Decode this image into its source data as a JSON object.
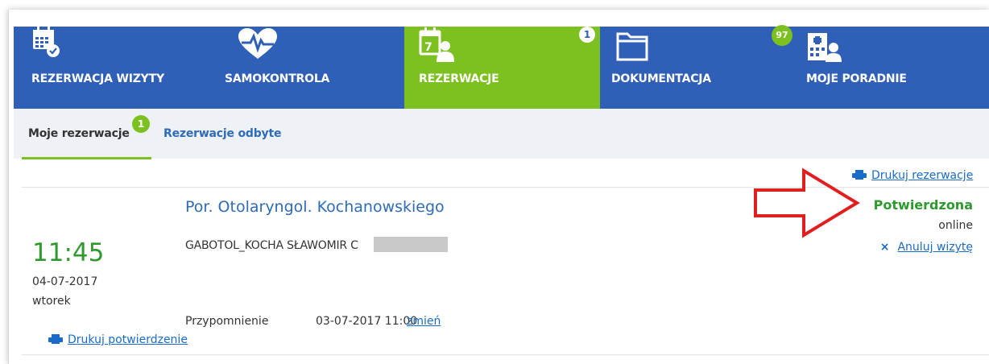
{
  "nav": {
    "tabs": [
      {
        "label": "REZERWACJA WIZYTY",
        "icon": "calendar-check-icon",
        "active": false,
        "badge": ""
      },
      {
        "label": "SAMOKONTROLA",
        "icon": "heart-pulse-icon",
        "active": false,
        "badge": ""
      },
      {
        "label": "REZERWACJE",
        "icon": "calendar-user-icon",
        "active": true,
        "badge": "1"
      },
      {
        "label": "DOKUMENTACJA",
        "icon": "folder-icon",
        "active": false,
        "badge": ""
      },
      {
        "label": "MOJE PORADNIE",
        "icon": "clinic-building-icon",
        "active": false,
        "badge": "97"
      }
    ],
    "color": "#2f5fb6",
    "active_color": "#7dc121"
  },
  "subtabs": {
    "items": [
      {
        "label": "Moje rezerwacje",
        "active": true,
        "badge": "1"
      },
      {
        "label": "Rezerwacje odbyte",
        "active": false
      }
    ]
  },
  "print_reservations": "Drukuj rezerwacje",
  "reservation": {
    "clinic": "Por. Otolaryngol. Kochanowskiego",
    "doctor": "GABOTOL_KOCHA SŁAWOMIR C",
    "time": "11:45",
    "date": "04-07-2017",
    "day": "wtorek",
    "reminder_label": "Przypomnienie",
    "reminder_value": "03-07-2017 11:00",
    "reminder_change": "zmień",
    "status": "Potwierdzona",
    "mode": "online",
    "cancel_label": "Anuluj wizytę",
    "cancel_icon": "×",
    "print_confirmation": "Drukuj potwierdzenie"
  },
  "colors": {
    "status_green": "#2e9a2e",
    "link_blue": "#1a6bc7",
    "arrow_red": "#e02020"
  }
}
